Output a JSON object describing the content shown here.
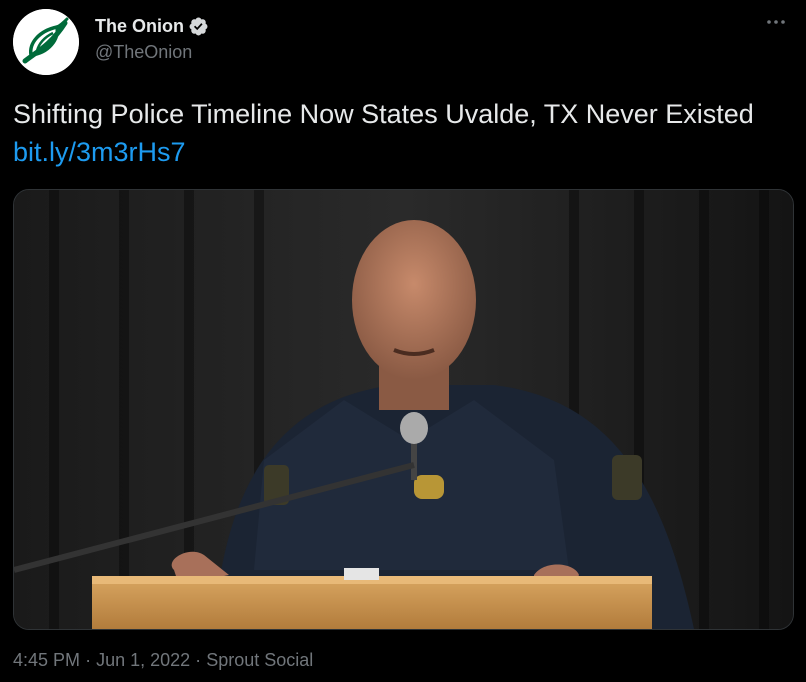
{
  "author": {
    "display_name": "The Onion",
    "handle": "@TheOnion",
    "verified": true,
    "avatar_icon": "onion-logo-icon",
    "brand_color": "#006b3a"
  },
  "tweet": {
    "text": "Shifting Police Timeline Now States Uvalde, TX Never Existed",
    "link_text": "bit.ly/3m3rHs7",
    "link_color": "#1d9bf0"
  },
  "media": {
    "type": "photo"
  },
  "meta": {
    "time": "4:45 PM",
    "separator": "·",
    "date": "Jun 1, 2022",
    "source": "Sprout Social"
  },
  "more_icon": "more-dots-icon"
}
